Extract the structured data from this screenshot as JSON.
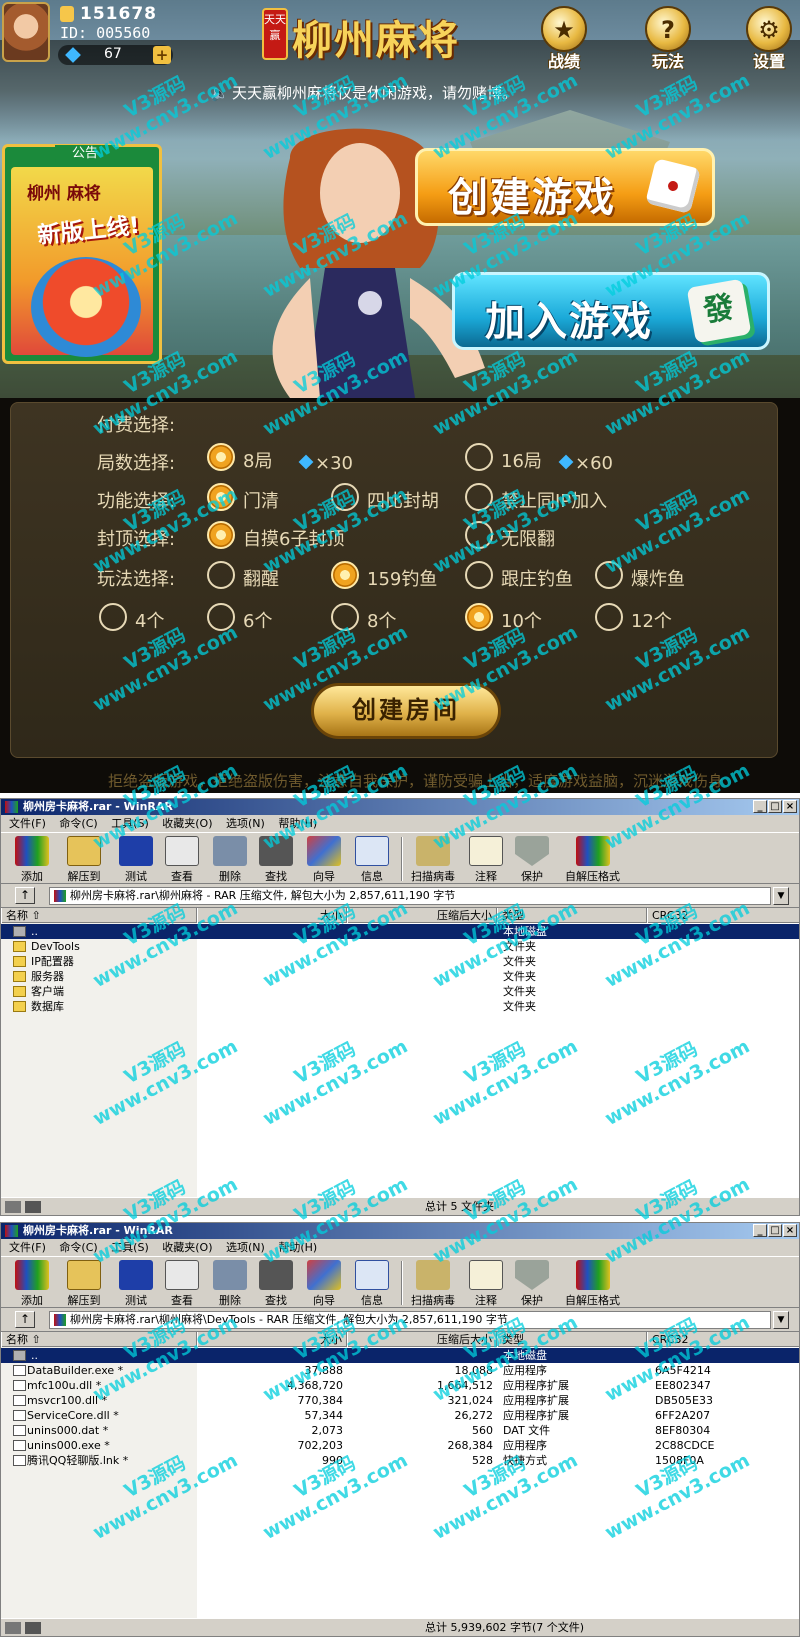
{
  "lobby": {
    "coins": "151678",
    "player_id": "ID: 005560",
    "gems": "67",
    "gem_plus": "+",
    "logo_badge": "天天赢",
    "logo_title": "柳州麻将",
    "buttons": {
      "record": "战绩",
      "rules": "玩法",
      "settings": "设置"
    },
    "notice_text": "天天赢柳州麻将仅是休闲游戏，请勿赌博。",
    "bulletin": {
      "header": "公告",
      "line1": "柳州 麻将",
      "line2": "新版上线!"
    },
    "create_game": "创建游戏",
    "join_game": "加入游戏",
    "tile_glyph": "發"
  },
  "dialog": {
    "pay_label": "付费选择:",
    "rounds_label": "局数选择:",
    "round_opts": [
      {
        "label": "8局",
        "cost": "×30",
        "selected": true
      },
      {
        "label": "16局",
        "cost": "×60",
        "selected": false
      }
    ],
    "function_label": "功能选择:",
    "function_opts": [
      {
        "label": "门清",
        "selected": true
      },
      {
        "label": "四比封胡",
        "selected": false
      },
      {
        "label": "禁止同IP加入",
        "selected": false
      }
    ],
    "cap_label": "封顶选择:",
    "cap_opts": [
      {
        "label": "自摸6子封顶",
        "selected": true
      },
      {
        "label": "无限翻",
        "selected": false
      }
    ],
    "play_label": "玩法选择:",
    "play_opts": [
      {
        "label": "翻醒",
        "selected": false
      },
      {
        "label": "159钓鱼",
        "selected": true
      },
      {
        "label": "跟庄钓鱼",
        "selected": false
      },
      {
        "label": "爆炸鱼",
        "selected": false
      }
    ],
    "count_opts": [
      {
        "label": "4个",
        "selected": false
      },
      {
        "label": "6个",
        "selected": false
      },
      {
        "label": "8个",
        "selected": false
      },
      {
        "label": "10个",
        "selected": true
      },
      {
        "label": "12个",
        "selected": false
      }
    ],
    "create_room": "创建房间",
    "footer": "拒绝盗版游戏，拒绝盗版伤害，注意自我保护，谨防受骗上当，适度游戏益脑，沉迷游戏伤身"
  },
  "rar_common": {
    "menu": [
      "文件(F)",
      "命令(C)",
      "工具(S)",
      "收藏夹(O)",
      "选项(N)",
      "帮助(H)"
    ],
    "toolbar": [
      "添加",
      "解压到",
      "测试",
      "查看",
      "删除",
      "查找",
      "向导",
      "信息",
      "扫描病毒",
      "注释",
      "保护",
      "自解压格式"
    ],
    "columns": [
      "名称",
      "大小",
      "压缩后大小",
      "类型",
      "CRC32"
    ],
    "up_arrow": "↑",
    "parent_row": "..",
    "parent_type": "本地磁盘"
  },
  "rar1": {
    "title": "柳州房卡麻将.rar - WinRAR",
    "path": "柳州房卡麻将.rar\\柳州麻将 - RAR 压缩文件, 解包大小为 2,857,611,190 字节",
    "rows": [
      {
        "name": "DevTools",
        "type": "文件夹"
      },
      {
        "name": "IP配置器",
        "type": "文件夹"
      },
      {
        "name": "服务器",
        "type": "文件夹"
      },
      {
        "name": "客户端",
        "type": "文件夹"
      },
      {
        "name": "数据库",
        "type": "文件夹"
      }
    ],
    "status": "总计 5 文件夹"
  },
  "rar2": {
    "title": "柳州房卡麻将.rar - WinRAR",
    "path": "柳州房卡麻将.rar\\柳州麻将\\DevTools - RAR 压缩文件, 解包大小为 2,857,611,190 字节",
    "rows": [
      {
        "name": "DataBuilder.exe *",
        "size": "37,888",
        "packed": "18,088",
        "type": "应用程序",
        "crc": "6A5F4214"
      },
      {
        "name": "mfc100u.dll *",
        "size": "4,368,720",
        "packed": "1,664,512",
        "type": "应用程序扩展",
        "crc": "EE802347"
      },
      {
        "name": "msvcr100.dll *",
        "size": "770,384",
        "packed": "321,024",
        "type": "应用程序扩展",
        "crc": "DB505E33"
      },
      {
        "name": "ServiceCore.dll *",
        "size": "57,344",
        "packed": "26,272",
        "type": "应用程序扩展",
        "crc": "6FF2A207"
      },
      {
        "name": "unins000.dat *",
        "size": "2,073",
        "packed": "560",
        "type": "DAT 文件",
        "crc": "8EF80304"
      },
      {
        "name": "unins000.exe *",
        "size": "702,203",
        "packed": "268,384",
        "type": "应用程序",
        "crc": "2C88CDCE"
      },
      {
        "name": "腾讯QQ轻聊版.lnk *",
        "size": "990",
        "packed": "528",
        "type": "快捷方式",
        "crc": "1508F0A"
      }
    ],
    "status": "总计 5,939,602 字节(7 个文件)"
  },
  "watermark": {
    "line1": "V3源码",
    "line2": "www.cnv3.com"
  },
  "colors": {
    "accent_orange": "#f59d14",
    "accent_cyan": "#1ba9d8",
    "selection_blue": "#0a246a",
    "watermark": "#00cddc"
  }
}
